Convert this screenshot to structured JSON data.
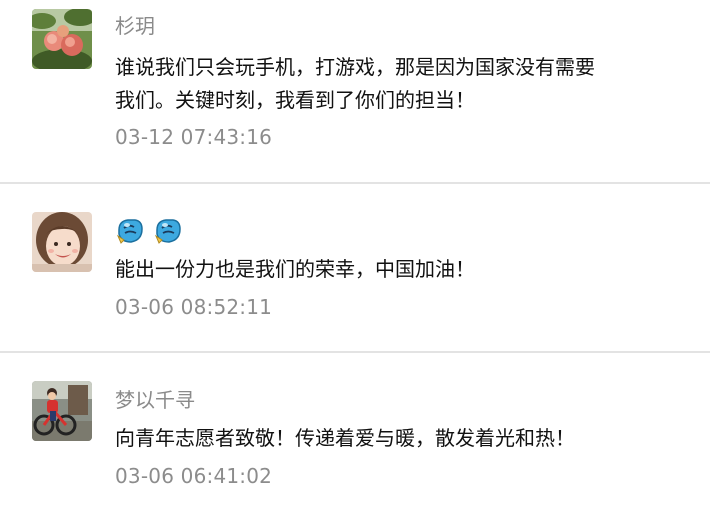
{
  "comments": [
    {
      "nickname": "杉玥",
      "avatar": "peach-tree-avatar",
      "content_lines": [
        "谁说我们只会玩手机，打游戏，那是因为国家没有需要",
        "我们。关键时刻，我看到了你们的担当！"
      ],
      "time": "03-12 07:43:16"
    },
    {
      "nickname": "",
      "avatar": "smiling-girl-avatar",
      "emoji": [
        "like-fist-emoji",
        "like-fist-emoji"
      ],
      "content_lines": [
        "能出一份力也是我们的荣幸，中国加油！"
      ],
      "time": "03-06 08:52:11"
    },
    {
      "nickname": "梦以千寻",
      "avatar": "child-on-bike-avatar",
      "content_lines": [
        "向青年志愿者致敬！传递着爱与暖，散发着光和热！"
      ],
      "time": "03-06 06:41:02"
    }
  ],
  "colors": {
    "nickname": "#8a8a8a",
    "content": "#111111",
    "time": "#8c8c8c",
    "divider": "#e3e3e3",
    "emoji": "#3da9e0"
  }
}
